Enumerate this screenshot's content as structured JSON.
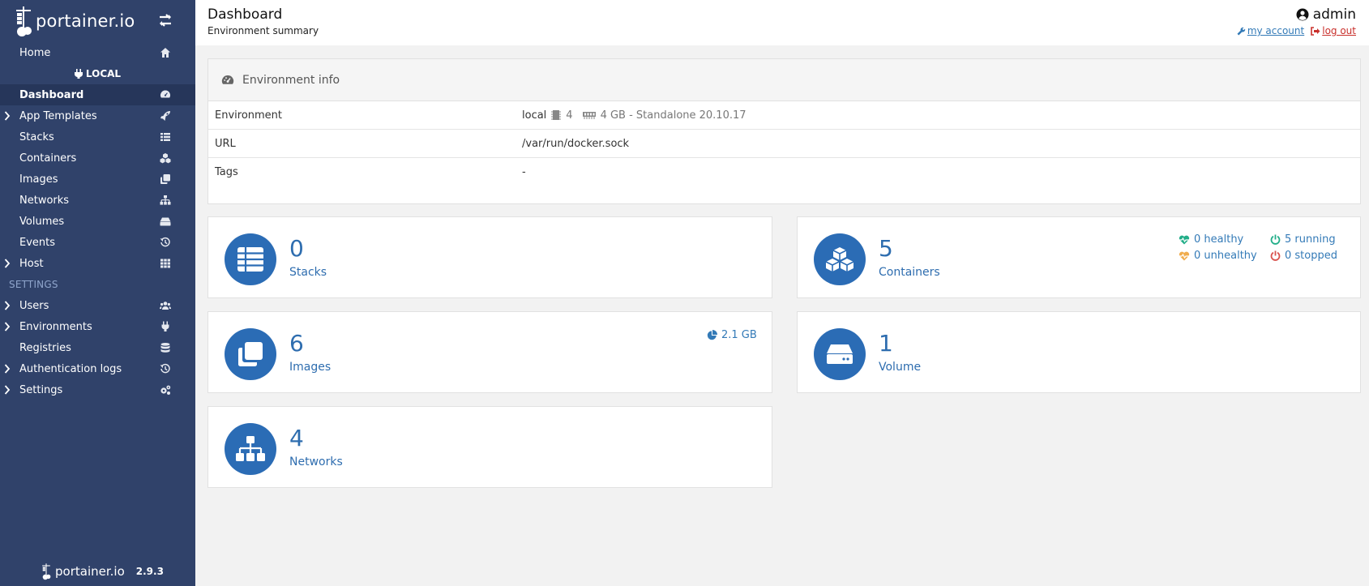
{
  "brand": {
    "logo_text": "portainer.io"
  },
  "sidebar": {
    "home": "Home",
    "env_name": "LOCAL",
    "items": [
      {
        "label": "Dashboard",
        "icon": "gauge-icon",
        "active": true,
        "caret": false
      },
      {
        "label": "App Templates",
        "icon": "rocket-icon",
        "caret": true
      },
      {
        "label": "Stacks",
        "icon": "list-icon",
        "caret": false
      },
      {
        "label": "Containers",
        "icon": "cubes-icon",
        "caret": false
      },
      {
        "label": "Images",
        "icon": "clone-icon",
        "caret": false
      },
      {
        "label": "Networks",
        "icon": "sitemap-icon",
        "caret": false
      },
      {
        "label": "Volumes",
        "icon": "hdd-icon",
        "caret": false
      },
      {
        "label": "Events",
        "icon": "history-icon",
        "caret": false
      },
      {
        "label": "Host",
        "icon": "grid-icon",
        "caret": true
      }
    ],
    "settings_title": "SETTINGS",
    "settings_items": [
      {
        "label": "Users",
        "icon": "users-icon",
        "caret": true
      },
      {
        "label": "Environments",
        "icon": "plug-icon",
        "caret": true
      },
      {
        "label": "Registries",
        "icon": "database-icon",
        "caret": false
      },
      {
        "label": "Authentication logs",
        "icon": "history-icon",
        "caret": true
      },
      {
        "label": "Settings",
        "icon": "cogs-icon",
        "caret": true
      }
    ],
    "footer_logo": "portainer.io",
    "version": "2.9.3"
  },
  "header": {
    "title": "Dashboard",
    "subtitle": "Environment summary",
    "user": "admin",
    "my_account": "my account",
    "log_out": "log out"
  },
  "env_info": {
    "title": "Environment info",
    "rows": [
      {
        "key": "Environment",
        "name": "local",
        "cpu": "4",
        "mem": "4 GB - Standalone 20.10.17"
      },
      {
        "key": "URL",
        "value": "/var/run/docker.sock"
      },
      {
        "key": "Tags",
        "value": "-"
      }
    ]
  },
  "stats": {
    "stacks": {
      "count": "0",
      "label": "Stacks"
    },
    "containers": {
      "count": "5",
      "label": "Containers",
      "healthy": "0 healthy",
      "running": "5 running",
      "unhealthy": "0 unhealthy",
      "stopped": "0 stopped"
    },
    "images": {
      "count": "6",
      "label": "Images",
      "size": "2.1 GB"
    },
    "volumes": {
      "count": "1",
      "label": "Volume"
    },
    "networks": {
      "count": "4",
      "label": "Networks"
    }
  },
  "colors": {
    "sidebar": "#30426a",
    "accent": "#2b6cb5",
    "healthy": "#23ae89",
    "unhealthy": "#f0ad4e",
    "stopped": "#d9534f"
  }
}
